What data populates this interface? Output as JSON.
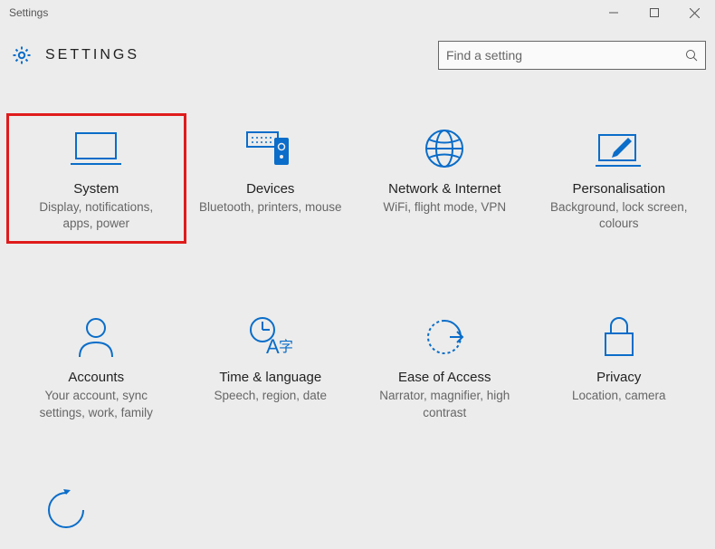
{
  "window_title": "Settings",
  "header": {
    "title": "SETTINGS"
  },
  "search": {
    "placeholder": "Find a setting"
  },
  "tiles": [
    {
      "label": "System",
      "desc": "Display, notifications, apps, power"
    },
    {
      "label": "Devices",
      "desc": "Bluetooth, printers, mouse"
    },
    {
      "label": "Network & Internet",
      "desc": "WiFi, flight mode, VPN"
    },
    {
      "label": "Personalisation",
      "desc": "Background, lock screen, colours"
    },
    {
      "label": "Accounts",
      "desc": "Your account, sync settings, work, family"
    },
    {
      "label": "Time & language",
      "desc": "Speech, region, date"
    },
    {
      "label": "Ease of Access",
      "desc": "Narrator, magnifier, high contrast"
    },
    {
      "label": "Privacy",
      "desc": "Location, camera"
    }
  ],
  "highlighted_tile_index": 0
}
